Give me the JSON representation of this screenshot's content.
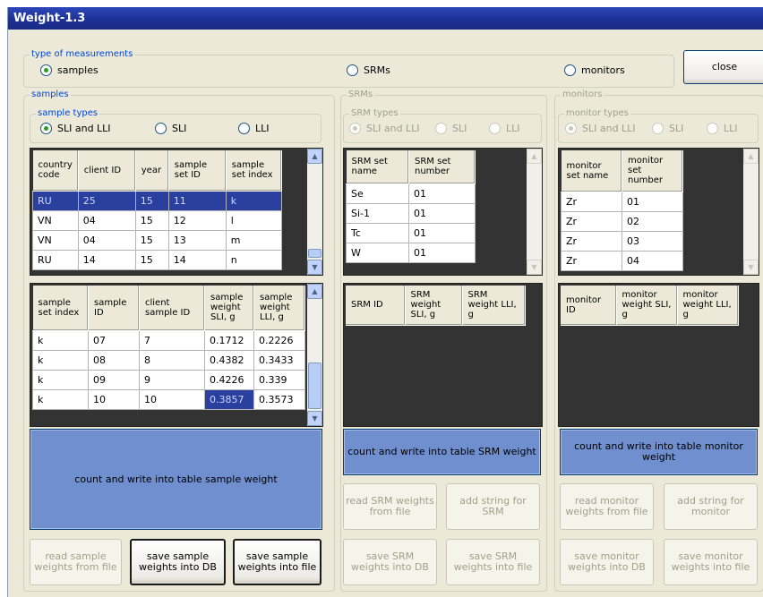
{
  "window": {
    "title": "Weight-1.3"
  },
  "measurement": {
    "caption": "type of measurements",
    "options": [
      "samples",
      "SRMs",
      "monitors"
    ],
    "selected": "samples",
    "close_label": "close"
  },
  "samples": {
    "caption": "samples",
    "types_caption": "sample types",
    "type_options": [
      "SLI and LLI",
      "SLI",
      "LLI"
    ],
    "sets_grid": {
      "headers": [
        "country code",
        "client ID",
        "year",
        "sample set ID",
        "sample set index"
      ],
      "rows": [
        [
          "RU",
          "25",
          "15",
          "11",
          "k"
        ],
        [
          "VN",
          "04",
          "15",
          "12",
          "l"
        ],
        [
          "VN",
          "04",
          "15",
          "13",
          "m"
        ],
        [
          "RU",
          "14",
          "15",
          "14",
          "n"
        ]
      ]
    },
    "samples_grid": {
      "headers": [
        "sample set index",
        "sample ID",
        "client sample ID",
        "sample weight SLI, g",
        "sample weight LLI, g"
      ],
      "rows": [
        [
          "k",
          "07",
          "7",
          "0.1712",
          "0.2226"
        ],
        [
          "k",
          "08",
          "8",
          "0.4382",
          "0.3433"
        ],
        [
          "k",
          "09",
          "9",
          "0.4226",
          "0.339"
        ],
        [
          "k",
          "10",
          "10",
          "0.3857",
          "0.3573"
        ]
      ]
    },
    "count_button": "count and write into table sample weight",
    "read_button": "read sample weights from file",
    "save_db_button": "save sample weights into DB",
    "save_file_button": "save sample weights into file"
  },
  "srms": {
    "caption": "SRMs",
    "types_caption": "SRM types",
    "type_options": [
      "SLI and LLI",
      "SLI",
      "LLI"
    ],
    "sets_grid": {
      "headers": [
        "SRM set name",
        "SRM set number"
      ],
      "rows": [
        [
          "Se",
          "01"
        ],
        [
          "Si-1",
          "01"
        ],
        [
          "Tc",
          "01"
        ],
        [
          "W",
          "01"
        ]
      ]
    },
    "weights_grid": {
      "headers": [
        "SRM ID",
        "SRM weight SLI, g",
        "SRM weight LLI, g"
      ]
    },
    "count_button": "count and write into table SRM weight",
    "read_button": "read SRM weights from file",
    "add_button": "add string for SRM",
    "save_db_button": "save SRM weights into DB",
    "save_file_button": "save SRM weights into file"
  },
  "monitors": {
    "caption": "monitors",
    "types_caption": "monitor types",
    "type_options": [
      "SLI and LLI",
      "SLI",
      "LLI"
    ],
    "sets_grid": {
      "headers": [
        "monitor set name",
        "monitor set number"
      ],
      "rows": [
        [
          "Zr",
          "01"
        ],
        [
          "Zr",
          "02"
        ],
        [
          "Zr",
          "03"
        ],
        [
          "Zr",
          "04"
        ]
      ]
    },
    "weights_grid": {
      "headers": [
        "monitor ID",
        "monitor weight SLI, g",
        "monitor weight LLI, g"
      ]
    },
    "count_button": "count and write into table monitor weight",
    "read_button": "read monitor weights from file",
    "add_button": "add string for monitor",
    "save_db_button": "save monitor weights into DB",
    "save_file_button": "save monitor weights into file"
  }
}
